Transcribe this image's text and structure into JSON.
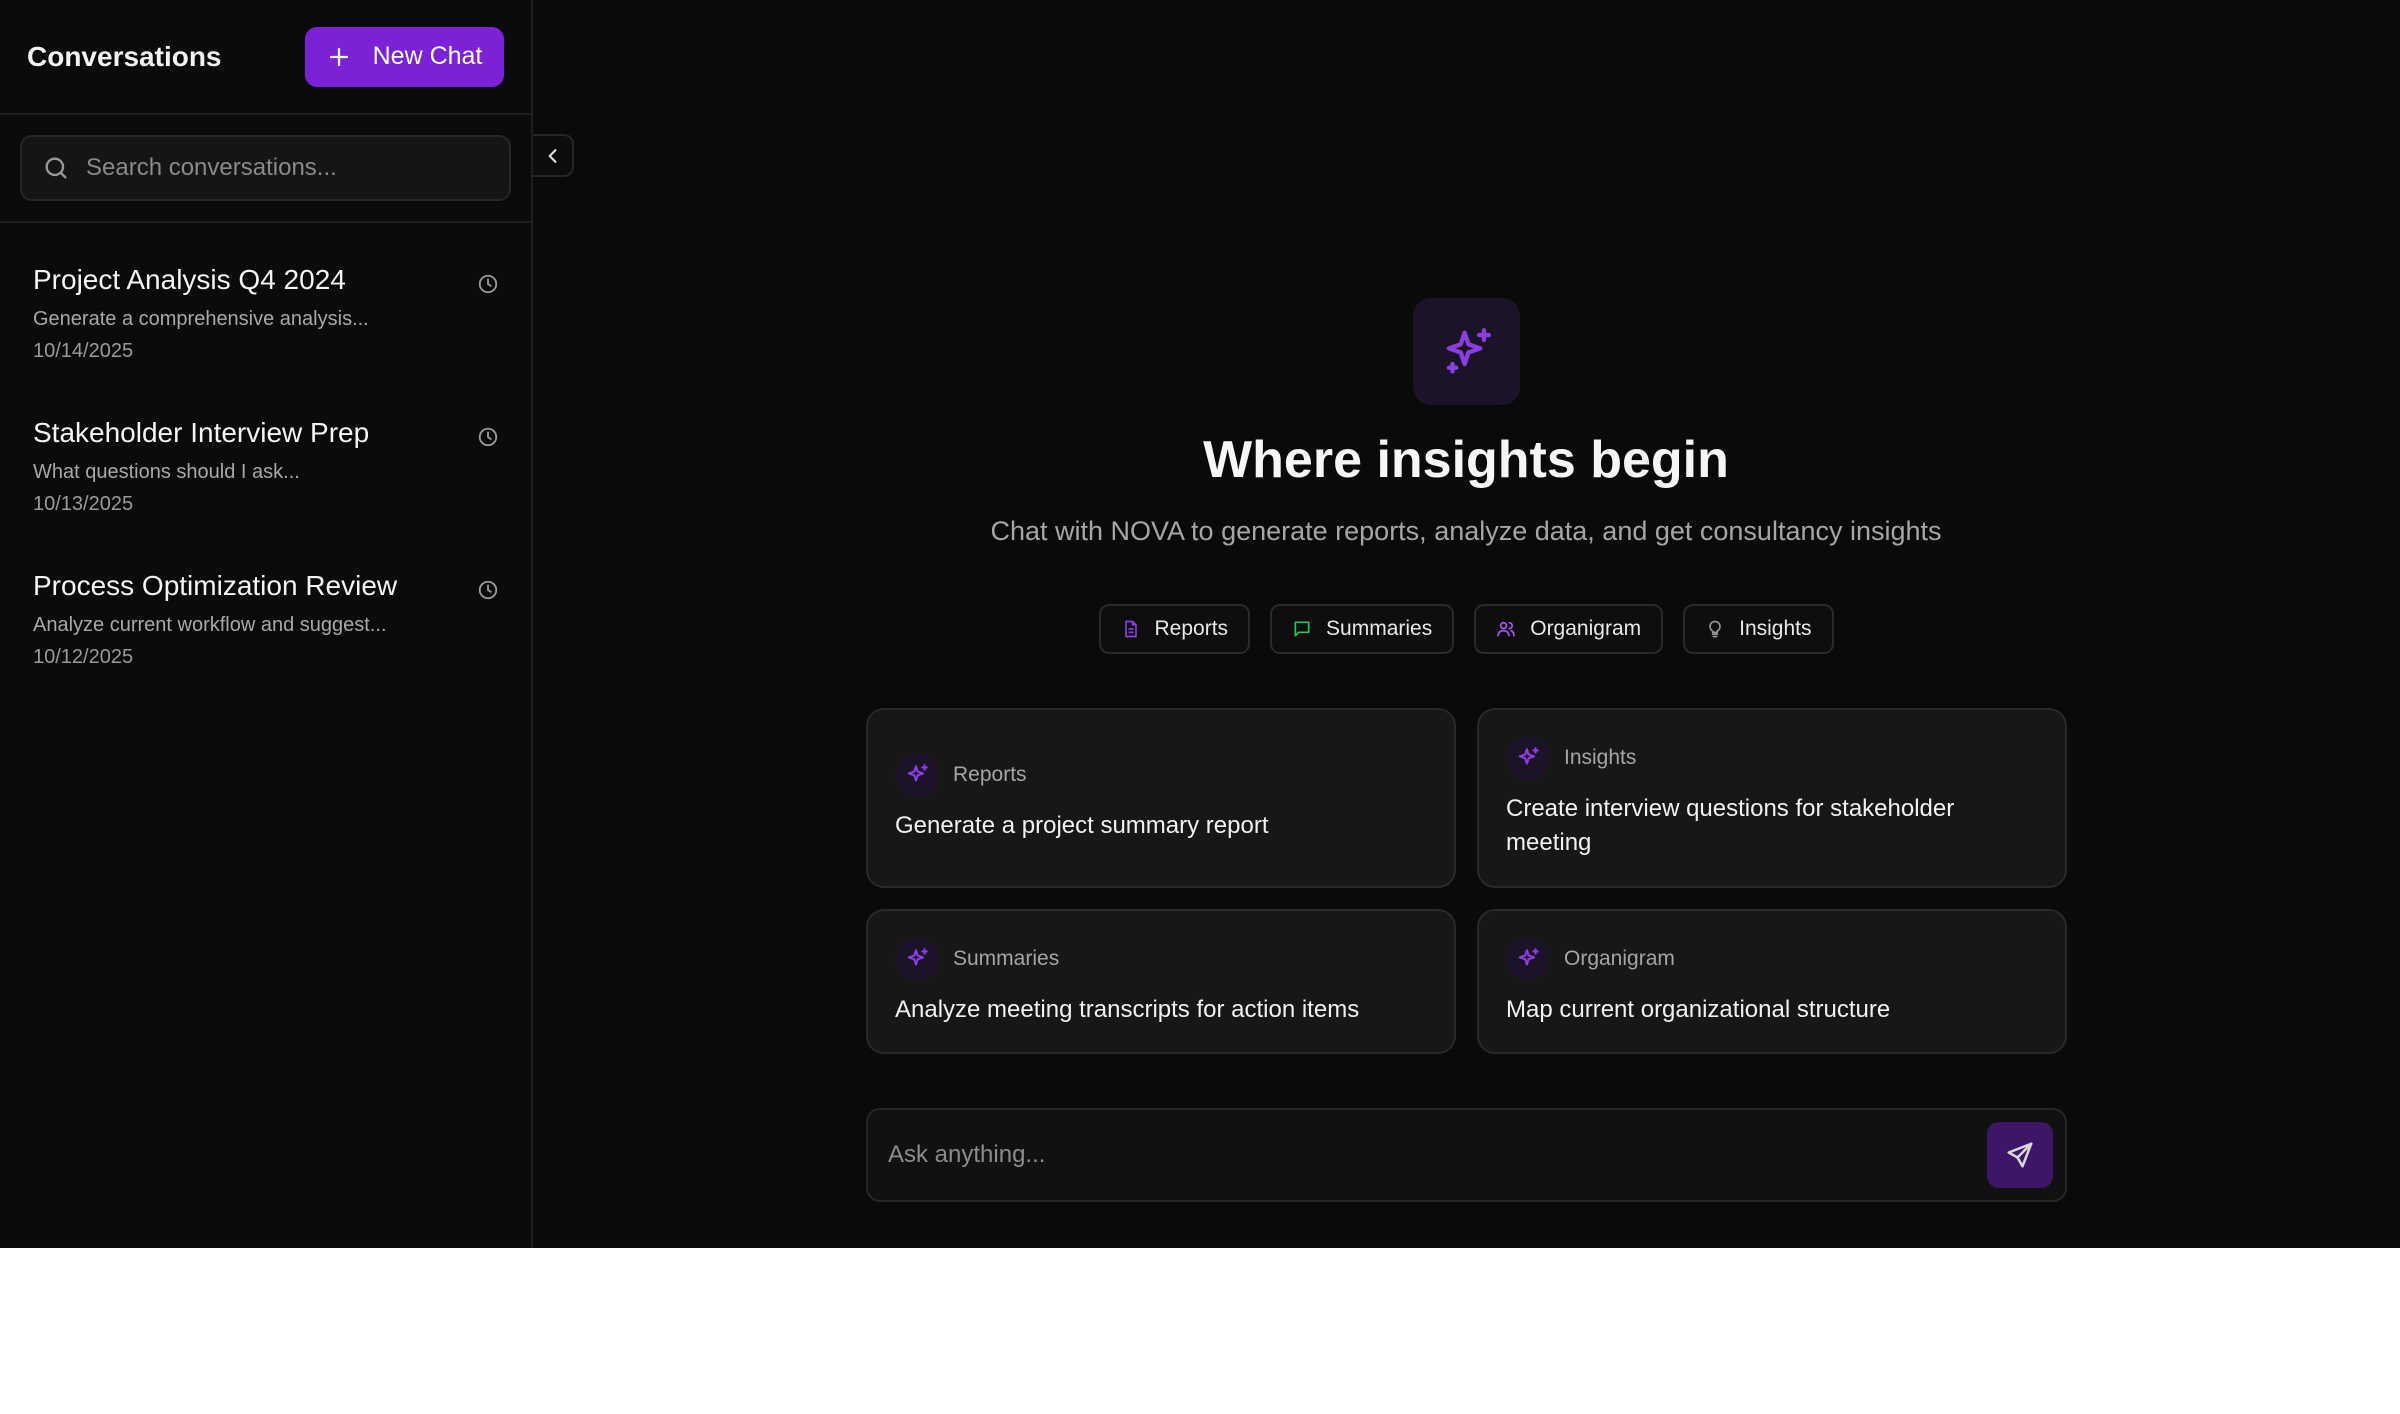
{
  "sidebar": {
    "title": "Conversations",
    "new_chat_label": "New Chat",
    "search_placeholder": "Search conversations...",
    "conversations": [
      {
        "title": "Project Analysis Q4 2024",
        "snippet": "Generate a comprehensive analysis...",
        "date": "10/14/2025"
      },
      {
        "title": "Stakeholder Interview Prep",
        "snippet": "What questions should I ask...",
        "date": "10/13/2025"
      },
      {
        "title": "Process Optimization Review",
        "snippet": "Analyze current workflow and suggest...",
        "date": "10/12/2025"
      }
    ]
  },
  "main": {
    "title": "Where insights begin",
    "subtitle": "Chat with NOVA to generate reports, analyze data, and get consultancy insights",
    "chips": [
      {
        "label": "Reports",
        "icon": "document-icon",
        "color": "#8b3fe0"
      },
      {
        "label": "Summaries",
        "icon": "message-icon",
        "color": "#22c55e"
      },
      {
        "label": "Organigram",
        "icon": "users-icon",
        "color": "#a855f7"
      },
      {
        "label": "Insights",
        "icon": "lightbulb-icon",
        "color": "#9a9a9a"
      }
    ],
    "cards": [
      {
        "category": "Reports",
        "text": "Generate a project summary report"
      },
      {
        "category": "Insights",
        "text": "Create interview questions for stakeholder meeting"
      },
      {
        "category": "Summaries",
        "text": "Analyze meeting transcripts for action items"
      },
      {
        "category": "Organigram",
        "text": "Map current organizational structure"
      }
    ],
    "composer_placeholder": "Ask anything..."
  },
  "colors": {
    "accent": "#7c22d6",
    "background": "#0a0a0a",
    "card": "#171717"
  }
}
